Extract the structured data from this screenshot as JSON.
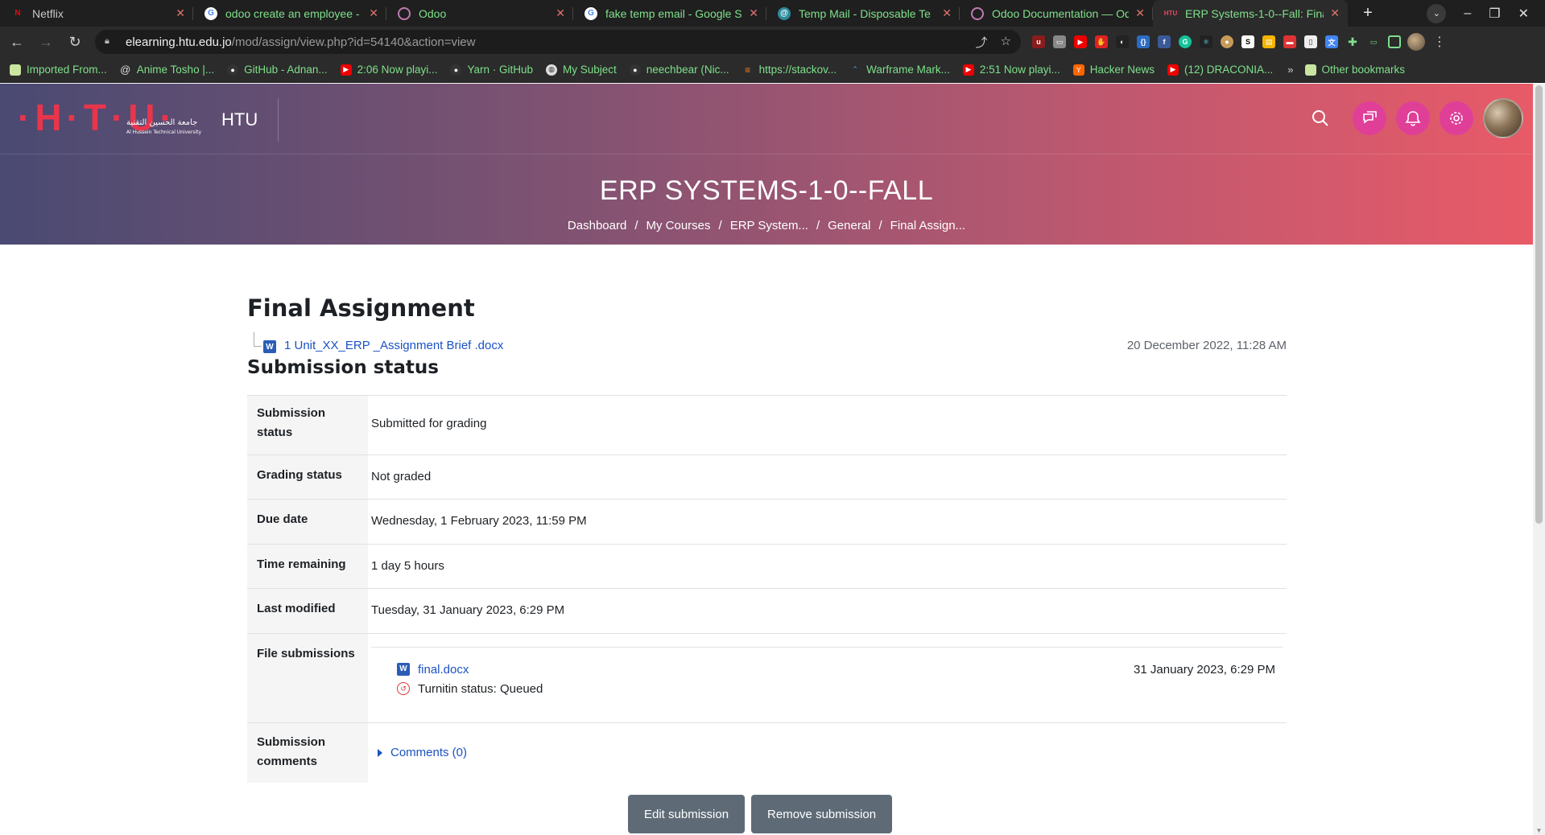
{
  "browser": {
    "tabs": [
      {
        "title": "Netflix",
        "favicon": "netflix-icon",
        "active": false
      },
      {
        "title": "odoo create an employee -",
        "favicon": "google-icon",
        "active": false
      },
      {
        "title": "Odoo",
        "favicon": "odoo-icon",
        "active": false
      },
      {
        "title": "fake temp email - Google S",
        "favicon": "google-icon",
        "active": false
      },
      {
        "title": "Temp Mail - Disposable Te",
        "favicon": "tempmail-icon",
        "active": false
      },
      {
        "title": "Odoo Documentation — Od",
        "favicon": "odoo-icon",
        "active": false
      },
      {
        "title": "ERP Systems-1-0--Fall: Fina",
        "favicon": "htu-icon",
        "active": true
      }
    ],
    "url_host": "elearning.htu.edu.jo",
    "url_path": "/mod/assign/view.php?id=54140&action=view",
    "bookmarks": [
      {
        "label": "Imported From...",
        "icon": "folder-icon"
      },
      {
        "label": "Anime Tosho |...",
        "icon": "at-icon"
      },
      {
        "label": "GitHub - Adnan...",
        "icon": "github-icon"
      },
      {
        "label": "2:06 Now playi...",
        "icon": "youtube-icon"
      },
      {
        "label": "Yarn · GitHub",
        "icon": "github-icon"
      },
      {
        "label": "My Subject",
        "icon": "globe-icon"
      },
      {
        "label": "neechbear (Nic...",
        "icon": "github-icon"
      },
      {
        "label": "https://stackov...",
        "icon": "stackoverflow-icon"
      },
      {
        "label": "Warframe Mark...",
        "icon": "warframe-icon"
      },
      {
        "label": "2:51 Now playi...",
        "icon": "youtube-icon"
      },
      {
        "label": "Hacker News",
        "icon": "hackernews-icon"
      },
      {
        "label": "(12) DRACONIA...",
        "icon": "youtube-icon"
      }
    ],
    "bookmarks_more": "»",
    "other_bookmarks": "Other bookmarks"
  },
  "site": {
    "name": "HTU",
    "logo_text": "HTU",
    "logo_arabic": "جامعة الحسين التقنية",
    "logo_english": "Al Hussein Technical University"
  },
  "page_header": {
    "title": "ERP SYSTEMS-1-0--FALL",
    "breadcrumb": [
      "Dashboard",
      "My Courses",
      "ERP System...",
      "General",
      "Final Assign..."
    ]
  },
  "assignment": {
    "title": "Final Assignment",
    "brief_file": "1 Unit_XX_ERP _Assignment Brief .docx",
    "brief_date": "20 December 2022, 11:28 AM",
    "section_title": "Submission status",
    "rows": {
      "submission_status": {
        "label": "Submission status",
        "value": "Submitted for grading"
      },
      "grading_status": {
        "label": "Grading status",
        "value": "Not graded"
      },
      "due_date": {
        "label": "Due date",
        "value": "Wednesday, 1 February 2023, 11:59 PM"
      },
      "time_remaining": {
        "label": "Time remaining",
        "value": "1 day 5 hours"
      },
      "last_modified": {
        "label": "Last modified",
        "value": "Tuesday, 31 January 2023, 6:29 PM"
      },
      "file_submissions": {
        "label": "File submissions",
        "file_name": "final.docx",
        "file_date": "31 January 2023, 6:29 PM",
        "turnitin_status": "Turnitin status: Queued"
      },
      "submission_comments": {
        "label": "Submission comments",
        "value": "Comments (0)"
      }
    },
    "buttons": {
      "edit": "Edit submission",
      "remove": "Remove submission"
    }
  },
  "colors": {
    "header_gradient_start": "#4a4a72",
    "header_gradient_end": "#e85a68",
    "accent_circle": "#e03f98",
    "link": "#1b52c4",
    "button": "#5e6b77"
  }
}
